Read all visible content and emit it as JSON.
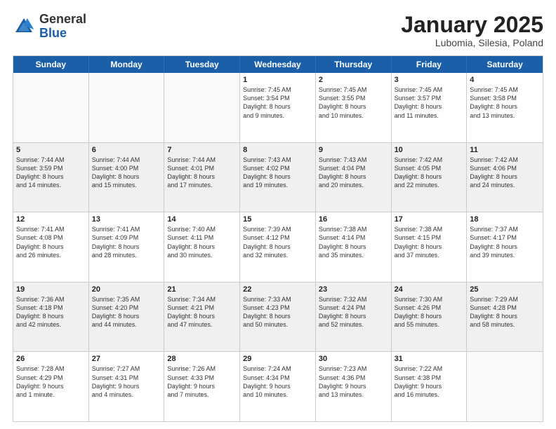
{
  "header": {
    "logo_general": "General",
    "logo_blue": "Blue",
    "title": "January 2025",
    "location": "Lubomia, Silesia, Poland"
  },
  "days_of_week": [
    "Sunday",
    "Monday",
    "Tuesday",
    "Wednesday",
    "Thursday",
    "Friday",
    "Saturday"
  ],
  "weeks": [
    [
      {
        "day": "",
        "info": "",
        "empty": true
      },
      {
        "day": "",
        "info": "",
        "empty": true
      },
      {
        "day": "",
        "info": "",
        "empty": true
      },
      {
        "day": "1",
        "info": "Sunrise: 7:45 AM\nSunset: 3:54 PM\nDaylight: 8 hours\nand 9 minutes."
      },
      {
        "day": "2",
        "info": "Sunrise: 7:45 AM\nSunset: 3:55 PM\nDaylight: 8 hours\nand 10 minutes."
      },
      {
        "day": "3",
        "info": "Sunrise: 7:45 AM\nSunset: 3:57 PM\nDaylight: 8 hours\nand 11 minutes."
      },
      {
        "day": "4",
        "info": "Sunrise: 7:45 AM\nSunset: 3:58 PM\nDaylight: 8 hours\nand 13 minutes."
      }
    ],
    [
      {
        "day": "5",
        "info": "Sunrise: 7:44 AM\nSunset: 3:59 PM\nDaylight: 8 hours\nand 14 minutes."
      },
      {
        "day": "6",
        "info": "Sunrise: 7:44 AM\nSunset: 4:00 PM\nDaylight: 8 hours\nand 15 minutes."
      },
      {
        "day": "7",
        "info": "Sunrise: 7:44 AM\nSunset: 4:01 PM\nDaylight: 8 hours\nand 17 minutes."
      },
      {
        "day": "8",
        "info": "Sunrise: 7:43 AM\nSunset: 4:02 PM\nDaylight: 8 hours\nand 19 minutes."
      },
      {
        "day": "9",
        "info": "Sunrise: 7:43 AM\nSunset: 4:04 PM\nDaylight: 8 hours\nand 20 minutes."
      },
      {
        "day": "10",
        "info": "Sunrise: 7:42 AM\nSunset: 4:05 PM\nDaylight: 8 hours\nand 22 minutes."
      },
      {
        "day": "11",
        "info": "Sunrise: 7:42 AM\nSunset: 4:06 PM\nDaylight: 8 hours\nand 24 minutes."
      }
    ],
    [
      {
        "day": "12",
        "info": "Sunrise: 7:41 AM\nSunset: 4:08 PM\nDaylight: 8 hours\nand 26 minutes."
      },
      {
        "day": "13",
        "info": "Sunrise: 7:41 AM\nSunset: 4:09 PM\nDaylight: 8 hours\nand 28 minutes."
      },
      {
        "day": "14",
        "info": "Sunrise: 7:40 AM\nSunset: 4:11 PM\nDaylight: 8 hours\nand 30 minutes."
      },
      {
        "day": "15",
        "info": "Sunrise: 7:39 AM\nSunset: 4:12 PM\nDaylight: 8 hours\nand 32 minutes."
      },
      {
        "day": "16",
        "info": "Sunrise: 7:38 AM\nSunset: 4:14 PM\nDaylight: 8 hours\nand 35 minutes."
      },
      {
        "day": "17",
        "info": "Sunrise: 7:38 AM\nSunset: 4:15 PM\nDaylight: 8 hours\nand 37 minutes."
      },
      {
        "day": "18",
        "info": "Sunrise: 7:37 AM\nSunset: 4:17 PM\nDaylight: 8 hours\nand 39 minutes."
      }
    ],
    [
      {
        "day": "19",
        "info": "Sunrise: 7:36 AM\nSunset: 4:18 PM\nDaylight: 8 hours\nand 42 minutes."
      },
      {
        "day": "20",
        "info": "Sunrise: 7:35 AM\nSunset: 4:20 PM\nDaylight: 8 hours\nand 44 minutes."
      },
      {
        "day": "21",
        "info": "Sunrise: 7:34 AM\nSunset: 4:21 PM\nDaylight: 8 hours\nand 47 minutes."
      },
      {
        "day": "22",
        "info": "Sunrise: 7:33 AM\nSunset: 4:23 PM\nDaylight: 8 hours\nand 50 minutes."
      },
      {
        "day": "23",
        "info": "Sunrise: 7:32 AM\nSunset: 4:24 PM\nDaylight: 8 hours\nand 52 minutes."
      },
      {
        "day": "24",
        "info": "Sunrise: 7:30 AM\nSunset: 4:26 PM\nDaylight: 8 hours\nand 55 minutes."
      },
      {
        "day": "25",
        "info": "Sunrise: 7:29 AM\nSunset: 4:28 PM\nDaylight: 8 hours\nand 58 minutes."
      }
    ],
    [
      {
        "day": "26",
        "info": "Sunrise: 7:28 AM\nSunset: 4:29 PM\nDaylight: 9 hours\nand 1 minute."
      },
      {
        "day": "27",
        "info": "Sunrise: 7:27 AM\nSunset: 4:31 PM\nDaylight: 9 hours\nand 4 minutes."
      },
      {
        "day": "28",
        "info": "Sunrise: 7:26 AM\nSunset: 4:33 PM\nDaylight: 9 hours\nand 7 minutes."
      },
      {
        "day": "29",
        "info": "Sunrise: 7:24 AM\nSunset: 4:34 PM\nDaylight: 9 hours\nand 10 minutes."
      },
      {
        "day": "30",
        "info": "Sunrise: 7:23 AM\nSunset: 4:36 PM\nDaylight: 9 hours\nand 13 minutes."
      },
      {
        "day": "31",
        "info": "Sunrise: 7:22 AM\nSunset: 4:38 PM\nDaylight: 9 hours\nand 16 minutes."
      },
      {
        "day": "",
        "info": "",
        "empty": true
      }
    ]
  ]
}
